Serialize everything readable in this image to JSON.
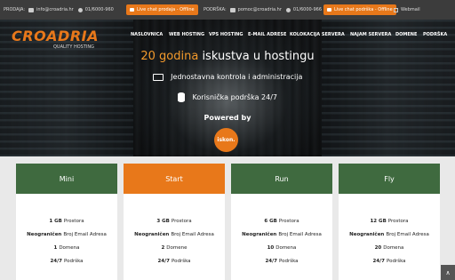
{
  "topbar": {
    "sales_label": "PRODAJA:",
    "sales_email": "info@croadria.hr",
    "sales_phone": "01/6000-960",
    "sales_chat": "Live chat prodaja - Offline",
    "support_label": "PODRŠKA:",
    "support_email": "pomoc@croadria.hr",
    "support_phone": "01/6000-966",
    "support_chat": "Live chat podrška - Offline",
    "webmail": "Webmail"
  },
  "logo": {
    "name": "CROADRIA",
    "tagline": "QUALITY HOSTING"
  },
  "nav": [
    "NASLOVNICA",
    "WEB HOSTING",
    "VPS HOSTING",
    "E-MAIL ADRESE",
    "KOLOKACIJA SERVERA",
    "NAJAM SERVERA",
    "DOMENE",
    "PODRŠKA"
  ],
  "hero": {
    "headline_accent": "20 godina",
    "headline_rest": "iskustva u hostingu",
    "feature_1": "Jednostavna kontrola i administracija",
    "feature_2": "Korisnička podrška 24/7",
    "powered_by": "Powered by",
    "partner": "iskon."
  },
  "plans": [
    {
      "name": "Mini",
      "storage_val": "1 GB",
      "storage_lbl": "Prostora",
      "email_val": "Neograničen",
      "email_lbl": "Broj Email Adresa",
      "domains_val": "1",
      "domains_lbl": "Domena",
      "support_val": "24/7",
      "support_lbl": "Podrška"
    },
    {
      "name": "Start",
      "storage_val": "3 GB",
      "storage_lbl": "Prostora",
      "email_val": "Neograničen",
      "email_lbl": "Broj Email Adresa",
      "domains_val": "2",
      "domains_lbl": "Domene",
      "support_val": "24/7",
      "support_lbl": "Podrška"
    },
    {
      "name": "Run",
      "storage_val": "6 GB",
      "storage_lbl": "Prostora",
      "email_val": "Neograničen",
      "email_lbl": "Broj Email Adresa",
      "domains_val": "10",
      "domains_lbl": "Domena",
      "support_val": "24/7",
      "support_lbl": "Podrška"
    },
    {
      "name": "Fly",
      "storage_val": "12 GB",
      "storage_lbl": "Prostora",
      "email_val": "Neograničen",
      "email_lbl": "Broj Email Adresa",
      "domains_val": "20",
      "domains_lbl": "Domena",
      "support_val": "24/7",
      "support_lbl": "Podrška"
    }
  ],
  "scroll_top_icon": "chevron-up-icon",
  "colors": {
    "accent": "#e8781a",
    "plan_header": "#3f6a3f",
    "topbar": "#3c3c3c"
  }
}
